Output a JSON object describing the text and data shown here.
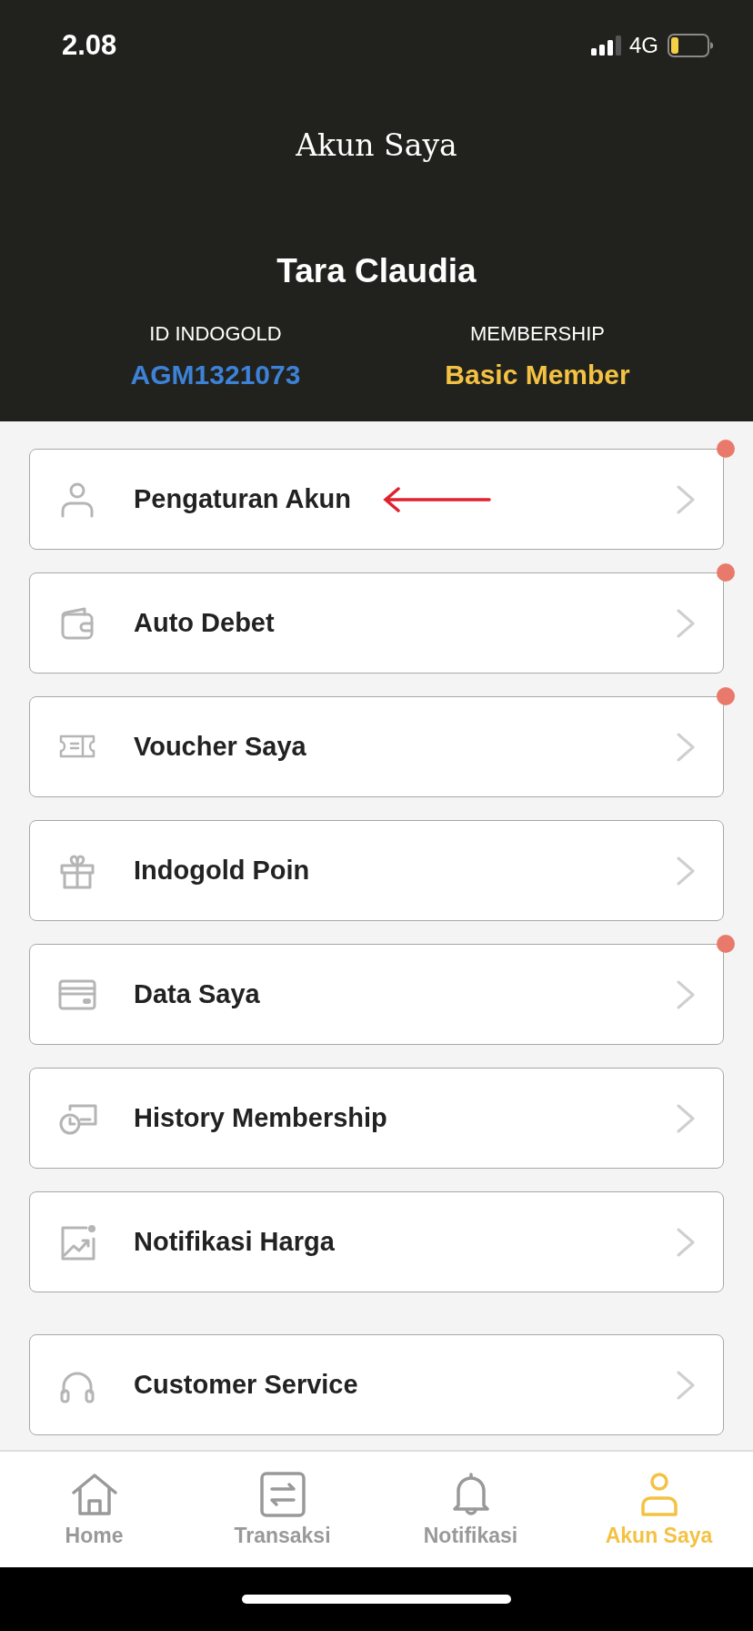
{
  "status_bar": {
    "time": "2.08",
    "network": "4G"
  },
  "header": {
    "title": "Akun Saya",
    "name": "Tara Claudia",
    "info": [
      {
        "label": "ID INDOGOLD",
        "value": "AGM1321073",
        "color": "#3d82d6"
      },
      {
        "label": "MEMBERSHIP",
        "value": "Basic Member",
        "color": "#f4c242"
      }
    ]
  },
  "menu_sections": [
    [
      {
        "label": "Pengaturan Akun",
        "kind": "person",
        "badge": true,
        "arrow_marked": true
      },
      {
        "label": "Auto Debet",
        "kind": "wallet",
        "badge": true,
        "arrow_marked": false
      },
      {
        "label": "Voucher Saya",
        "kind": "ticket",
        "badge": true,
        "arrow_marked": false
      },
      {
        "label": "Indogold Poin",
        "kind": "gift",
        "badge": false,
        "arrow_marked": false
      },
      {
        "label": "Data Saya",
        "kind": "card",
        "badge": true,
        "arrow_marked": false
      },
      {
        "label": "History Membership",
        "kind": "history",
        "badge": false,
        "arrow_marked": false
      },
      {
        "label": "Notifikasi Harga",
        "kind": "chart",
        "badge": false,
        "arrow_marked": false
      }
    ],
    [
      {
        "label": "Customer Service",
        "kind": "headset",
        "badge": false,
        "arrow_marked": false
      }
    ]
  ],
  "tab_bar": [
    {
      "label": "Home",
      "kind": "home",
      "selected": false
    },
    {
      "label": "Transaksi",
      "kind": "transfer",
      "selected": false
    },
    {
      "label": "Notifikasi",
      "kind": "bell",
      "selected": false
    },
    {
      "label": "Akun Saya",
      "kind": "person",
      "selected": true
    }
  ]
}
